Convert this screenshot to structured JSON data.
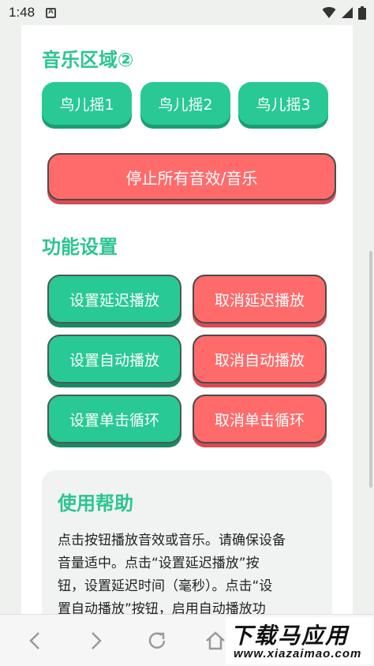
{
  "status": {
    "time": "1:48"
  },
  "music": {
    "title": "音乐区域②",
    "buttons": [
      "鸟儿摇1",
      "鸟儿摇2",
      "鸟儿摇3"
    ],
    "stop_label": "停止所有音效/音乐"
  },
  "functions": {
    "title": "功能设置",
    "set_delay": "设置延迟播放",
    "cancel_delay": "取消延迟播放",
    "set_auto": "设置自动播放",
    "cancel_auto": "取消自动播放",
    "set_loop": "设置单击循环",
    "cancel_loop": "取消单击循环"
  },
  "help": {
    "title": "使用帮助",
    "lines": [
      "点击按钮播放音效或音乐。请确保设备",
      "音量适中。点击“设置延迟播放”按",
      "钮，设置延迟时间（毫秒）。点击“设",
      "置自动播放”按钮，启用自动播放功"
    ]
  },
  "watermark": {
    "top": "下载马应用",
    "bottom": "www.xiazaimao.com"
  },
  "colors": {
    "green": "#28c994",
    "red": "#ff6b6b",
    "title_green": "#2bc592"
  },
  "icons": [
    "wifi-icon",
    "signal-icon",
    "battery-icon",
    "back-icon",
    "forward-icon",
    "reload-icon",
    "home-icon"
  ]
}
